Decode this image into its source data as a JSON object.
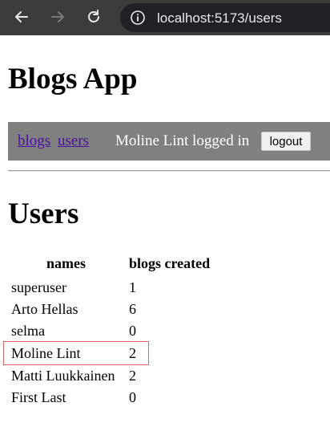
{
  "browser": {
    "url": "localhost:5173/users",
    "icons": [
      "back-arrow-icon",
      "forward-arrow-icon",
      "reload-icon",
      "info-icon"
    ]
  },
  "app": {
    "title": "Blogs App"
  },
  "menu": {
    "blogs_link": "blogs",
    "users_link": "users",
    "logged_in_text": "Moline Lint logged in",
    "logout_label": "logout"
  },
  "users_page": {
    "heading": "Users",
    "columns": [
      "names",
      "blogs created"
    ],
    "rows": [
      {
        "name": "superuser",
        "blogs": "1"
      },
      {
        "name": "Arto Hellas",
        "blogs": "6"
      },
      {
        "name": "selma",
        "blogs": "0"
      },
      {
        "name": "Moline Lint",
        "blogs": "2"
      },
      {
        "name": "Matti Luukkainen",
        "blogs": "2"
      },
      {
        "name": "First Last",
        "blogs": "0"
      }
    ]
  },
  "colors": {
    "toolbar": "#3c3c3c",
    "address_bar": "#202124",
    "menu_bar": "#808080",
    "link": "#4b0fa0",
    "highlight": "#e06666"
  }
}
